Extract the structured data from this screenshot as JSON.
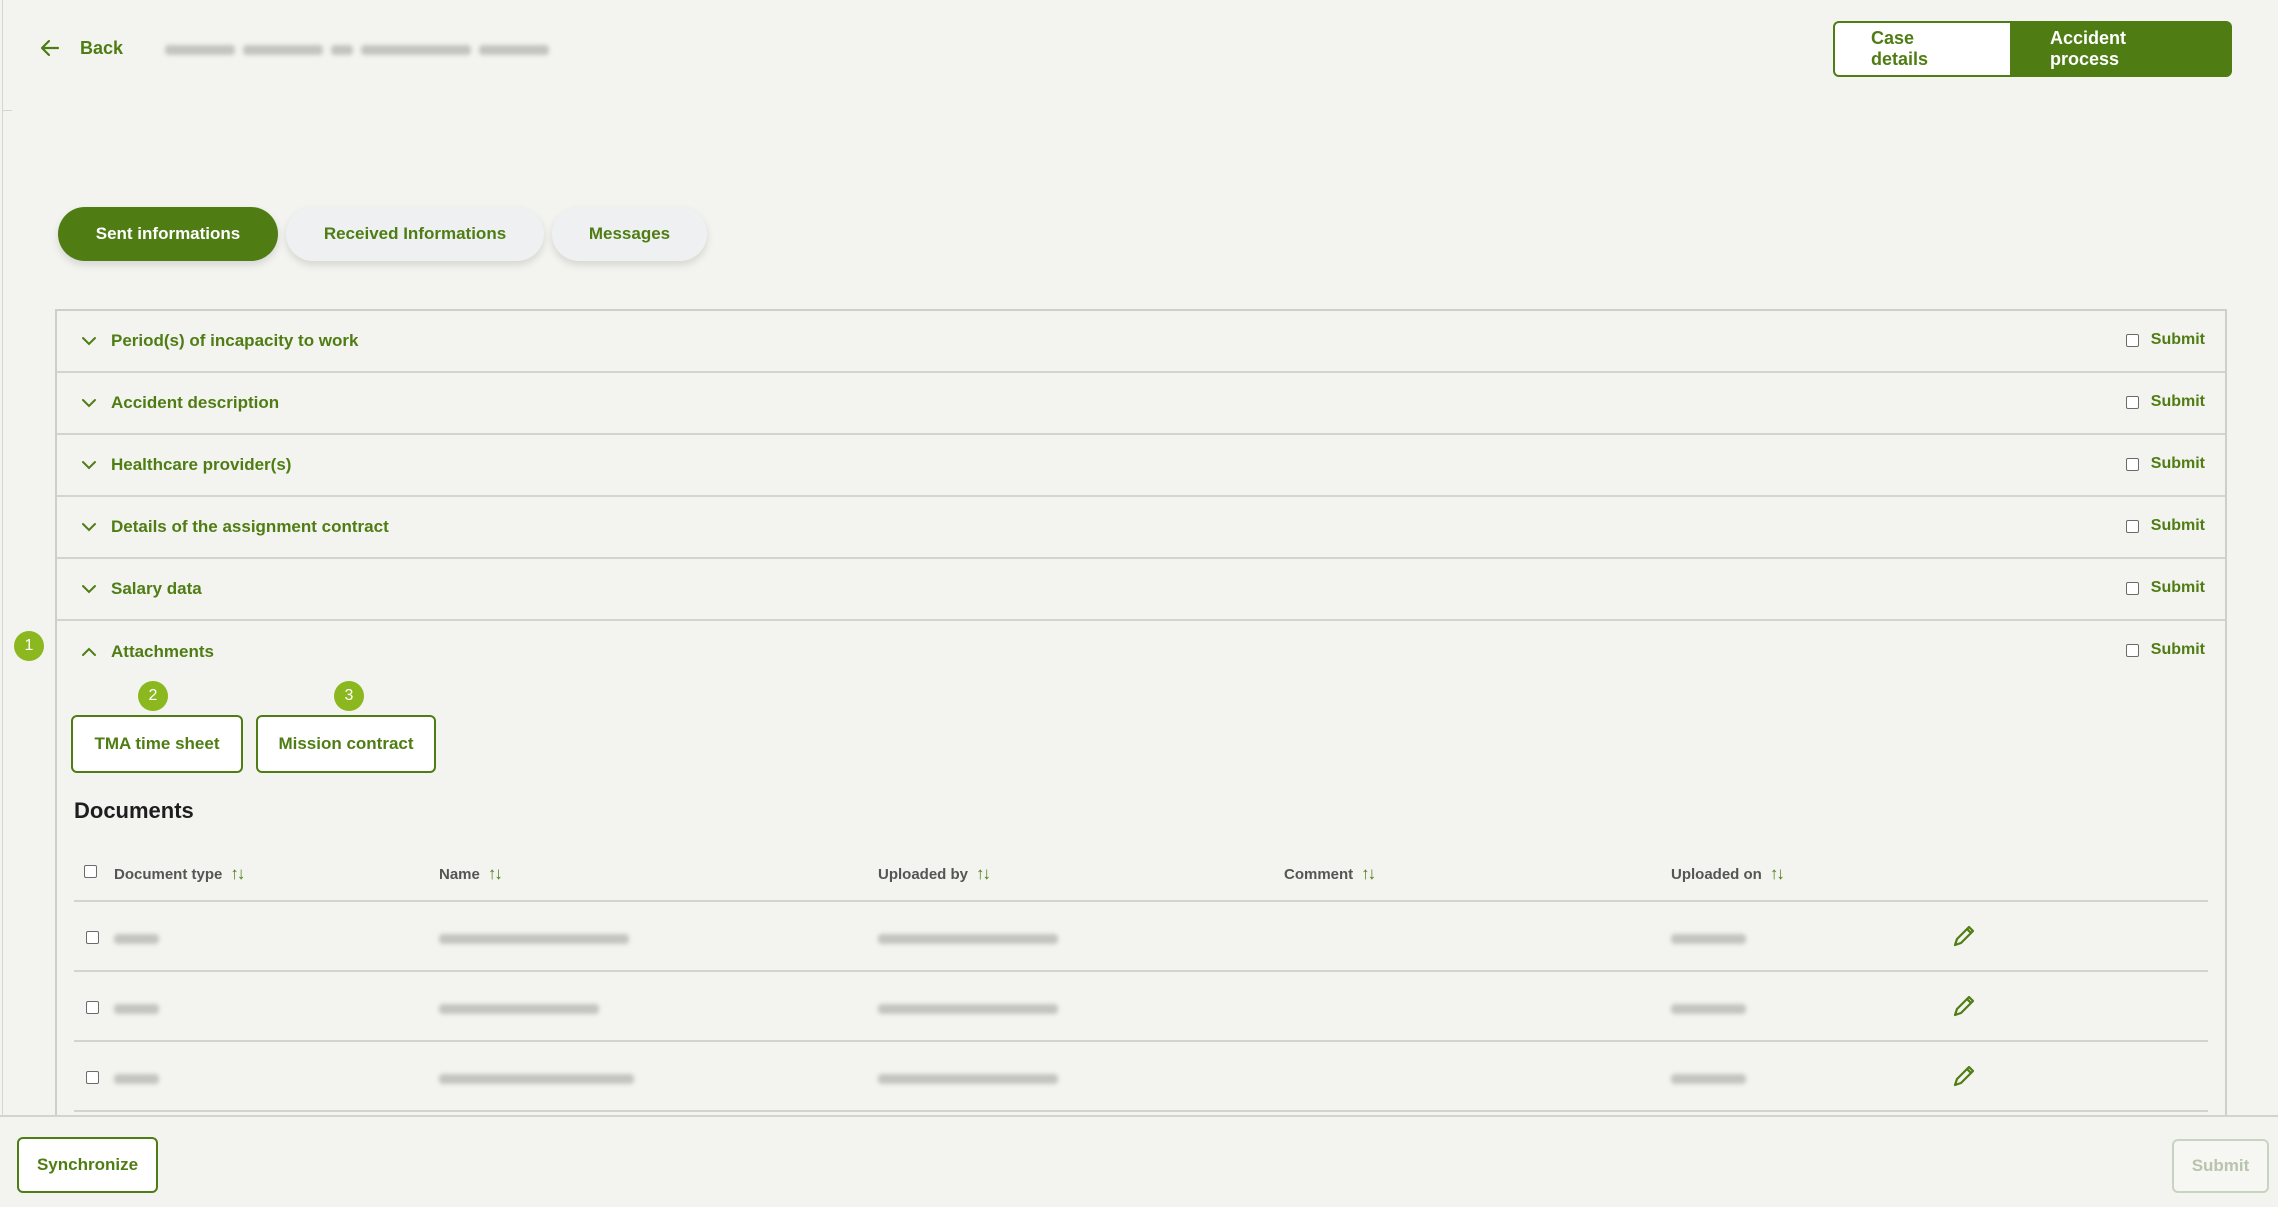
{
  "header": {
    "back_label": "Back",
    "case_details_label": "Case details",
    "accident_process_label": "Accident process"
  },
  "tabs": [
    {
      "label": "Sent informations",
      "active": true
    },
    {
      "label": "Received Informations",
      "active": false
    },
    {
      "label": "Messages",
      "active": false
    }
  ],
  "sections": [
    {
      "title": "Period(s) of incapacity to work",
      "submit_label": "Submit"
    },
    {
      "title": "Accident description",
      "submit_label": "Submit"
    },
    {
      "title": "Healthcare provider(s)",
      "submit_label": "Submit"
    },
    {
      "title": "Details of the assignment contract",
      "submit_label": "Submit"
    },
    {
      "title": "Salary data",
      "submit_label": "Submit"
    },
    {
      "title": "Attachments",
      "submit_label": "Submit"
    }
  ],
  "badges": [
    "1",
    "2",
    "3"
  ],
  "attachments": {
    "tma_label": "TMA time sheet",
    "mission_label": "Mission contract"
  },
  "documents": {
    "title": "Documents",
    "columns": [
      "Document type",
      "Name",
      "Uploaded by",
      "Comment",
      "Uploaded on"
    ],
    "sort_glyph": "↑↓"
  },
  "footer": {
    "synchronize_label": "Synchronize",
    "submit_label": "Submit"
  },
  "colors": {
    "brand_green": "#4f7d14",
    "badge_green": "#8bb81f",
    "background": "#f3f3ef"
  },
  "icons": [
    "arrow-left-icon",
    "chevron-down-icon",
    "chevron-up-icon",
    "pencil-icon",
    "sort-icon"
  ]
}
